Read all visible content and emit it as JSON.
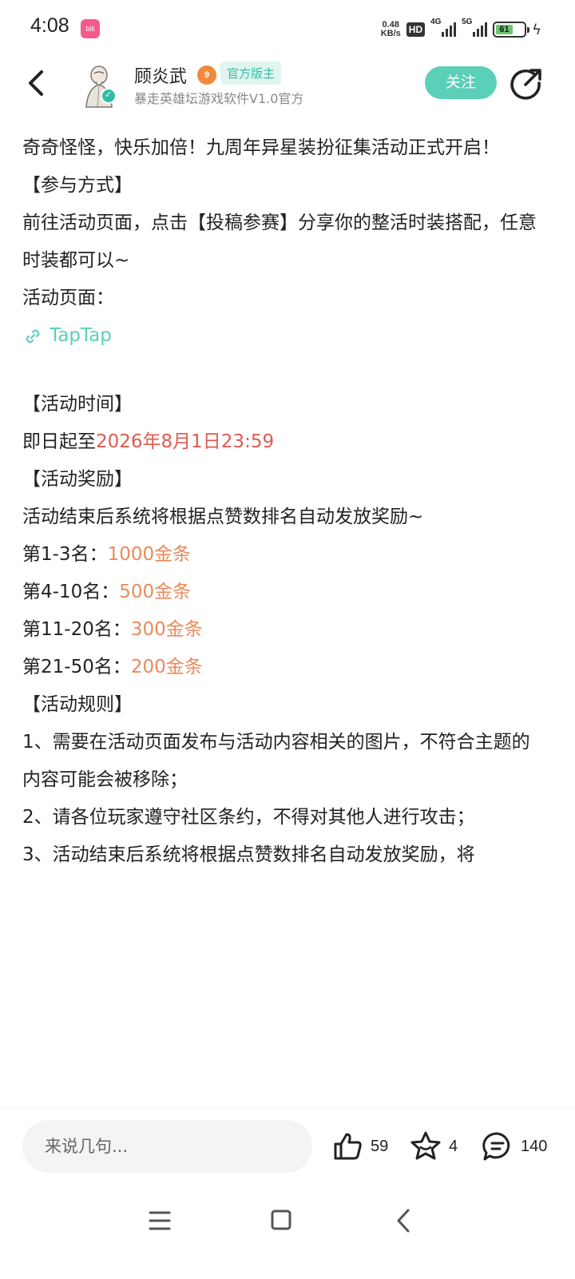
{
  "status_bar": {
    "time": "4:08",
    "app_icon_label": "bilibili",
    "net_speed_value": "0.48",
    "net_speed_unit": "KB/s",
    "hd_label": "HD",
    "net1_label": "4G",
    "net2_label": "5G",
    "battery_level": "61",
    "battery_percent": 61,
    "icons": [
      "bilibili-icon",
      "hd-icon",
      "signal-4g-icon",
      "signal-5g-icon",
      "battery-icon",
      "charging-icon"
    ]
  },
  "header": {
    "author_name": "顾炎武",
    "level": "9",
    "role_badge": "官方版主",
    "subtitle": "暴走英雄坛游戏软件V1.0官方",
    "follow_label": "关注",
    "accent_color": "#5ccfb8"
  },
  "post": {
    "intro": "奇奇怪怪，快乐加倍！九周年异星装扮征集活动正式开启！",
    "section_participate": "【参与方式】",
    "participate_text": "前往活动页面，点击【投稿参赛】分享你的整活时装搭配，任意时装都可以~",
    "activity_page_label": "活动页面：",
    "link_text": "TapTap",
    "section_time": "【活动时间】",
    "time_prefix": "即日起至",
    "time_value": "2026年8月1日23:59",
    "section_reward": "【活动奖励】",
    "reward_intro": "活动结束后系统将根据点赞数排名自动发放奖励~",
    "rewards": [
      {
        "rank": "第1-3名：",
        "prize": "1000金条"
      },
      {
        "rank": "第4-10名：",
        "prize": "500金条"
      },
      {
        "rank": "第11-20名：",
        "prize": "300金条"
      },
      {
        "rank": "第21-50名：",
        "prize": "200金条"
      }
    ],
    "section_rules": "【活动规则】",
    "rules": [
      "1、需要在活动页面发布与活动内容相关的图片，不符合主题的内容可能会被移除；",
      "2、请各位玩家遵守社区条约，不得对其他人进行攻击；",
      "3、活动结束后系统将根据点赞数排名自动发放奖励，将"
    ]
  },
  "bottom_bar": {
    "comment_placeholder": "来说几句...",
    "like_count": "59",
    "favorite_count": "4",
    "comment_count": "140"
  },
  "nav_bar": {
    "icons": [
      "menu-icon",
      "home-icon",
      "back-icon"
    ]
  }
}
